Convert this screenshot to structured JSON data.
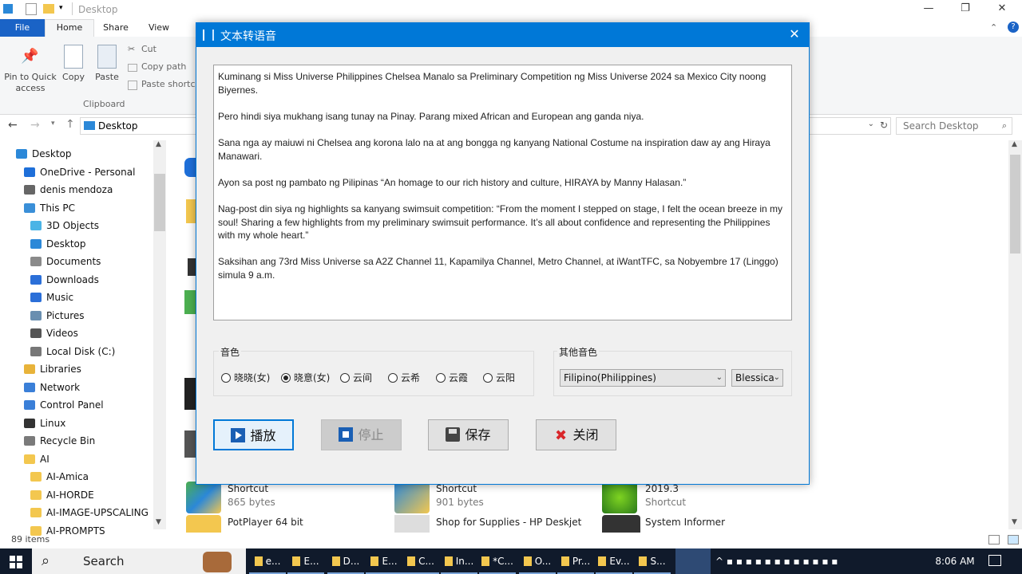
{
  "explorer": {
    "window_title": "Desktop",
    "tabs": [
      "File",
      "Home",
      "Share",
      "View"
    ],
    "ribbon": {
      "pin_label": "Pin to Quick access",
      "copy_label": "Copy",
      "paste_label": "Paste",
      "cut_label": "Cut",
      "copy_path_label": "Copy path",
      "paste_shortcut_label": "Paste shortcut",
      "group_label": "Clipboard"
    },
    "address": "Desktop",
    "search_placeholder": "Search Desktop",
    "nav": [
      {
        "label": "Desktop",
        "icon": "desktop-icon",
        "color": "#2b88d8"
      },
      {
        "label": "OneDrive - Personal",
        "icon": "cloud-icon",
        "color": "#1e6fd9"
      },
      {
        "label": "denis mendoza",
        "icon": "user-icon",
        "color": "#666666"
      },
      {
        "label": "This PC",
        "icon": "computer-icon",
        "color": "#3a8fd8"
      },
      {
        "label": "3D Objects",
        "icon": "cube-icon",
        "color": "#4bb4e6"
      },
      {
        "label": "Desktop",
        "icon": "desktop-icon",
        "color": "#2b88d8"
      },
      {
        "label": "Documents",
        "icon": "document-icon",
        "color": "#8a8a8a"
      },
      {
        "label": "Downloads",
        "icon": "download-icon",
        "color": "#2b6fd8"
      },
      {
        "label": "Music",
        "icon": "music-icon",
        "color": "#2b6fd8"
      },
      {
        "label": "Pictures",
        "icon": "pictures-icon",
        "color": "#6a8fb0"
      },
      {
        "label": "Videos",
        "icon": "video-icon",
        "color": "#555555"
      },
      {
        "label": "Local Disk (C:)",
        "icon": "drive-icon",
        "color": "#777777"
      },
      {
        "label": "Libraries",
        "icon": "library-icon",
        "color": "#e8b33a"
      },
      {
        "label": "Network",
        "icon": "network-icon",
        "color": "#3a7fd8"
      },
      {
        "label": "Control Panel",
        "icon": "control-panel-icon",
        "color": "#3a7fd8"
      },
      {
        "label": "Linux",
        "icon": "linux-icon",
        "color": "#333333"
      },
      {
        "label": "Recycle Bin",
        "icon": "recycle-bin-icon",
        "color": "#7a7a7a"
      },
      {
        "label": "AI",
        "icon": "folder-icon",
        "color": "#f3c74f"
      },
      {
        "label": "AI-Amica",
        "icon": "folder-icon",
        "color": "#f3c74f"
      },
      {
        "label": "AI-HORDE",
        "icon": "folder-icon",
        "color": "#f3c74f"
      },
      {
        "label": "AI-IMAGE-UPSCALING",
        "icon": "folder-icon",
        "color": "#f3c74f"
      },
      {
        "label": "AI-PROMPTS",
        "icon": "folder-icon",
        "color": "#f3c74f"
      }
    ],
    "files": [
      {
        "name": "Shortcut",
        "sub": "865 bytes"
      },
      {
        "name": "Shortcut",
        "sub": "901 bytes"
      },
      {
        "name": "2019.3",
        "sub": "Shortcut"
      },
      {
        "name": "PotPlayer 64 bit",
        "sub": ""
      },
      {
        "name": "Shop for Supplies - HP Deskjet",
        "sub": ""
      },
      {
        "name": "System Informer",
        "sub": ""
      }
    ],
    "status": "89 items"
  },
  "dialog": {
    "title": "文本转语音",
    "text": [
      "Kuminang si Miss Universe Philippines Chelsea Manalo  sa Preliminary Competition ng Miss Universe 2024 sa Mexico City noong Biyernes.",
      "Pero hindi siya mukhang isang tunay na Pinay. Parang mixed African and European ang ganda niya.",
      "Sana nga ay maiuwi ni Chelsea ang korona lalo na at ang bongga ng kanyang National Costume na inspiration daw ay ang Hiraya Manawari.",
      "Ayon sa post ng pambato ng Pilipinas “An homage to our rich history and culture, HIRAYA by Manny Halasan.”",
      "Nag-post din siya ng highlights sa kanyang swimsuit competition:  “From the moment I stepped on stage, I felt the ocean breeze in my soul! Sharing a few highlights from my preliminary swimsuit performance. It’s all about confidence and representing the Philippines with my whole heart.”",
      "Saksihan ang 73rd  Miss Universe sa A2Z Channel 11, Kapamilya Channel, Metro Channel, at iWantTFC, sa Nobyembre 17 (Linggo) simula 9 a.m."
    ],
    "voice_group_label": "音色",
    "voices": [
      {
        "label": "晓晓(女)",
        "selected": false
      },
      {
        "label": "晓意(女)",
        "selected": true
      },
      {
        "label": "云间",
        "selected": false
      },
      {
        "label": "云希",
        "selected": false
      },
      {
        "label": "云霞",
        "selected": false
      },
      {
        "label": "云阳",
        "selected": false
      }
    ],
    "other_group_label": "其他音色",
    "language_value": "Filipino(Philippines)",
    "voice_value": "Blessica",
    "buttons": {
      "play": "播放",
      "stop": "停止",
      "save": "保存",
      "close": "关闭"
    }
  },
  "taskbar": {
    "search_label": "Search",
    "items": [
      "e...",
      "E...",
      "D...",
      "E...",
      "C...",
      "In...",
      "*C...",
      "O...",
      "Pr...",
      "Ev...",
      "S..."
    ],
    "time": "8:06 AM"
  }
}
